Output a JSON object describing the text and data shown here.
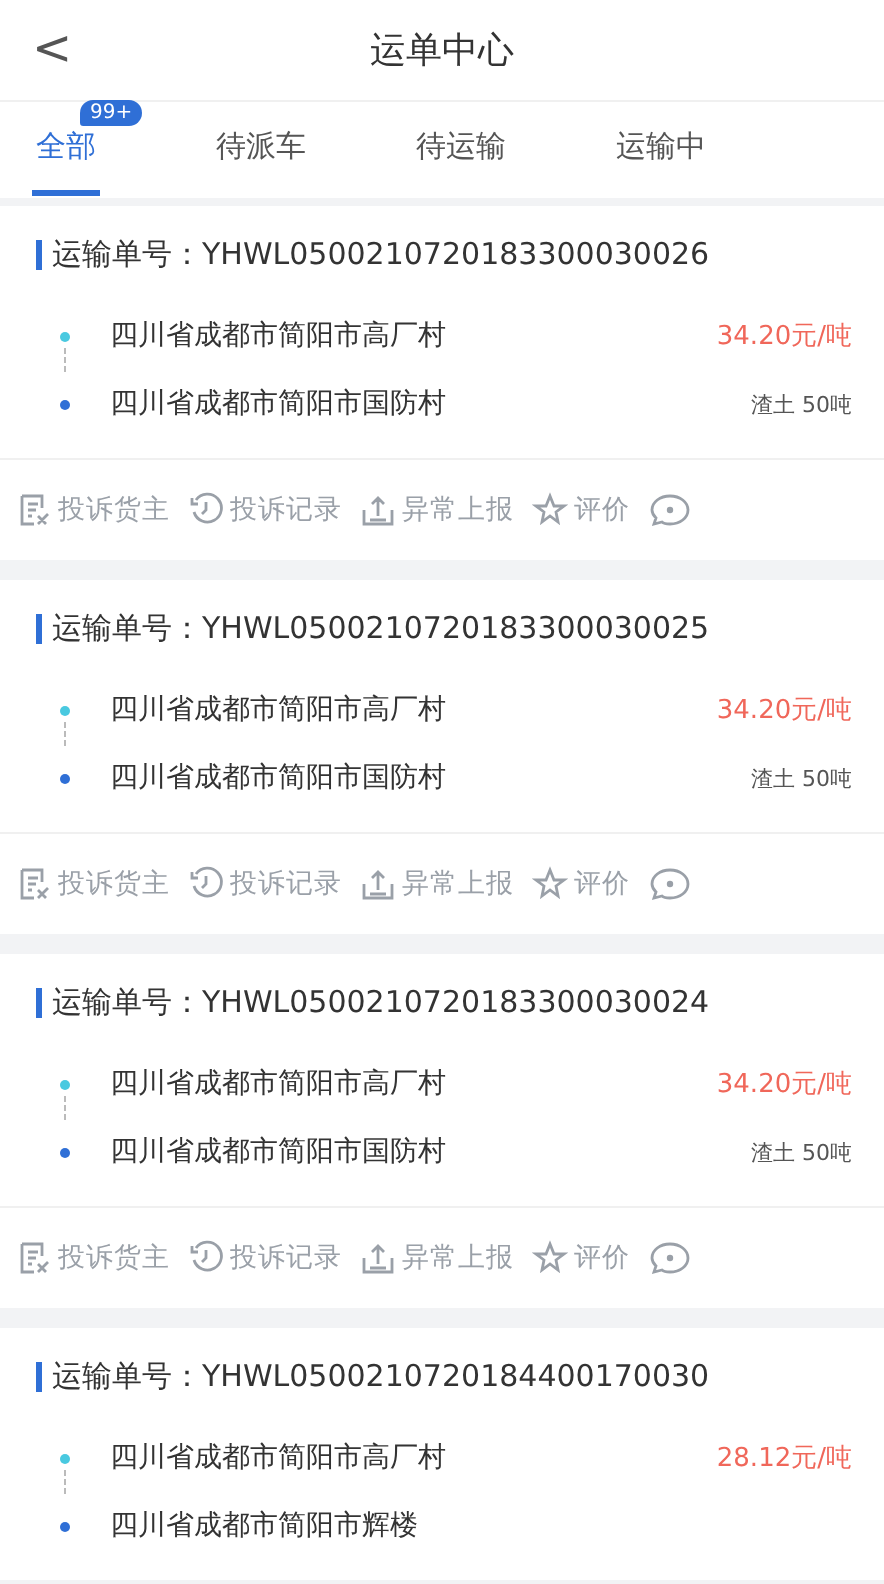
{
  "header": {
    "back_icon": "<",
    "title": "运单中心"
  },
  "tabs": [
    {
      "label": "全部",
      "selected": true,
      "badge": "99+"
    },
    {
      "label": "待派车",
      "selected": false
    },
    {
      "label": "待运输",
      "selected": false
    },
    {
      "label": "运输中",
      "selected": false
    }
  ],
  "orders": [
    {
      "number": "运输单号：YHWL0500210720183300030026",
      "stops": [
        {
          "kind": "origin",
          "address": "四川省成都市简阳市高厂村"
        },
        {
          "kind": "destination",
          "address": "四川省成都市简阳市国防村"
        }
      ],
      "price": "34.20元/吨",
      "cargo": "渣土 50吨",
      "actions": [
        {
          "kind": "complain",
          "label": "投诉货主"
        },
        {
          "kind": "history",
          "label": "投诉记录"
        },
        {
          "kind": "report",
          "label": "异常上报"
        },
        {
          "kind": "rate",
          "label": "评价"
        },
        {
          "kind": "chat"
        }
      ]
    },
    {
      "number": "运输单号：YHWL0500210720183300030025",
      "stops": [
        {
          "kind": "origin",
          "address": "四川省成都市简阳市高厂村"
        },
        {
          "kind": "destination",
          "address": "四川省成都市简阳市国防村"
        }
      ],
      "price": "34.20元/吨",
      "cargo": "渣土 50吨",
      "actions": [
        {
          "kind": "complain",
          "label": "投诉货主"
        },
        {
          "kind": "history",
          "label": "投诉记录"
        },
        {
          "kind": "report",
          "label": "异常上报"
        },
        {
          "kind": "rate",
          "label": "评价"
        },
        {
          "kind": "chat"
        }
      ]
    },
    {
      "number": "运输单号：YHWL0500210720183300030024",
      "stops": [
        {
          "kind": "origin",
          "address": "四川省成都市简阳市高厂村"
        },
        {
          "kind": "destination",
          "address": "四川省成都市简阳市国防村"
        }
      ],
      "price": "34.20元/吨",
      "cargo": "渣土 50吨",
      "actions": [
        {
          "kind": "complain",
          "label": "投诉货主"
        },
        {
          "kind": "history",
          "label": "投诉记录"
        },
        {
          "kind": "report",
          "label": "异常上报"
        },
        {
          "kind": "rate",
          "label": "评价"
        },
        {
          "kind": "chat"
        }
      ]
    },
    {
      "number": "运输单号：YHWL0500210720184400170030",
      "stops": [
        {
          "kind": "origin",
          "address": "四川省成都市简阳市高厂村"
        },
        {
          "kind": "destination",
          "address": "四川省成都市简阳市辉楼"
        }
      ],
      "price": "28.12元/吨"
    }
  ]
}
